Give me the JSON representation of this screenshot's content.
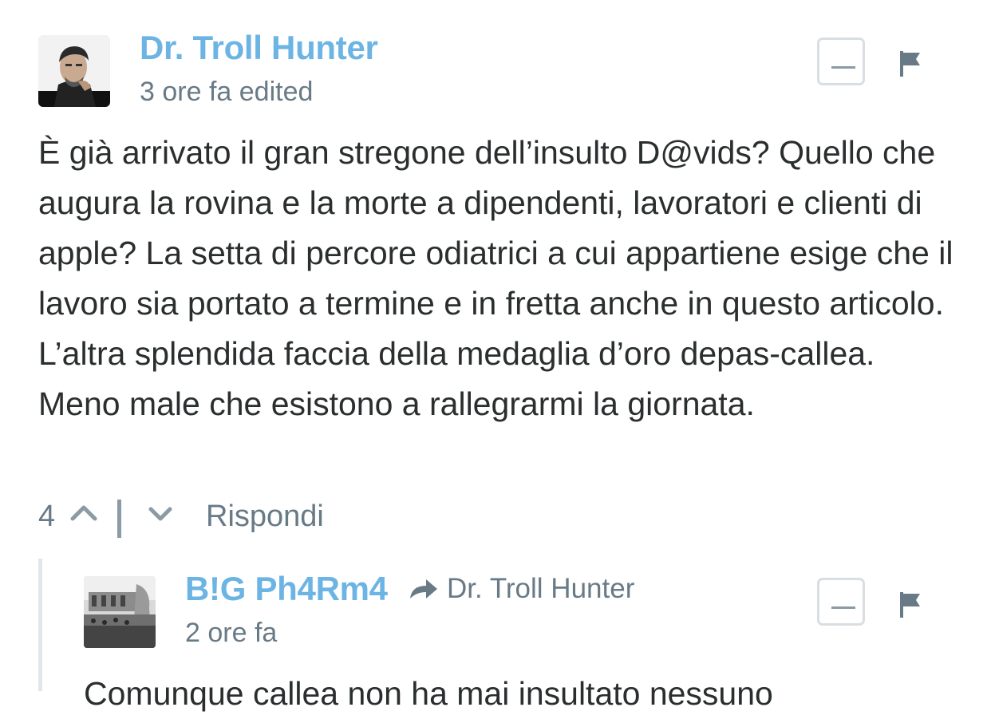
{
  "comments": [
    {
      "author": "Dr. Troll Hunter",
      "meta": "3 ore fa edited",
      "avatar_icon": "man-portrait-icon",
      "body": "È già arrivato il gran stregone dell’insulto D@vids? Quello che augura la rovina e la morte a dipendenti, lavoratori e clienti di apple? La setta di percore odiatrici a cui appartiene esige che il lavoro sia portato a termine e in fretta anche in questo articolo. L’altra splendida faccia della medaglia d’oro depas-callea. Meno male che esistono a rallegrarmi la giornata.",
      "votes": "4",
      "reply_label": "Rispondi",
      "icons": [
        "minus-icon",
        "flag-icon",
        "chevron-up-icon",
        "chevron-down-icon"
      ]
    },
    {
      "author": "B!G Ph4Rm4",
      "reply_to": "Dr. Troll Hunter",
      "meta": "2 ore fa",
      "avatar_icon": "crowd-photo-icon",
      "body": "Comunque callea non ha mai insultato nessuno",
      "icons": [
        "reply-arrow-icon",
        "minus-icon",
        "flag-icon"
      ]
    }
  ],
  "colors": {
    "author": "#6cb4e4",
    "meta": "#687a86",
    "text": "#2a2e2e",
    "button_border": "#d8dee2",
    "thread_line": "#e1e6e9"
  }
}
